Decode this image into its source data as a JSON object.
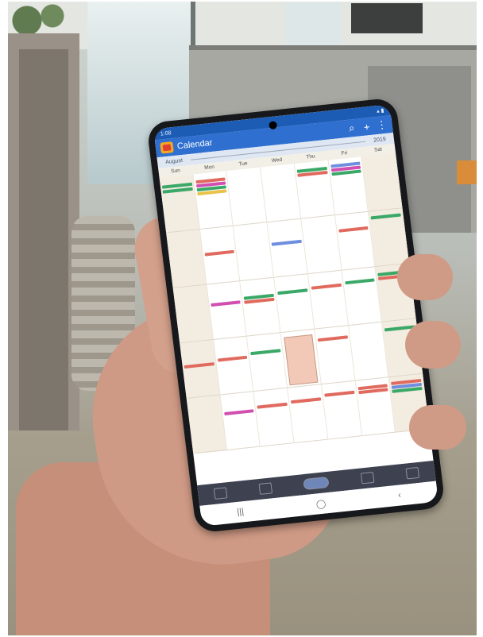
{
  "status_bar": {
    "time": "1:08"
  },
  "app": {
    "title": "Calendar"
  },
  "month_bar": {
    "left": "August",
    "right": "2019"
  },
  "day_headers": [
    "Sun",
    "Mon",
    "Tue",
    "Wed",
    "Thu",
    "Fri",
    "Sat"
  ],
  "icons": [
    "search-icon",
    "add-icon",
    "overflow-menu-icon"
  ],
  "nav_bar": [
    "recent-apps-icon",
    "home-icon",
    "back-icon"
  ],
  "colors": {
    "appbar": "#2f6fd0",
    "statusbar": "#1d5cb4",
    "event_red": "#e06a5e",
    "event_green": "#3aa866",
    "event_pink": "#d04fb0",
    "event_blue": "#6f8ee0",
    "event_yellow": "#e9c24a"
  }
}
